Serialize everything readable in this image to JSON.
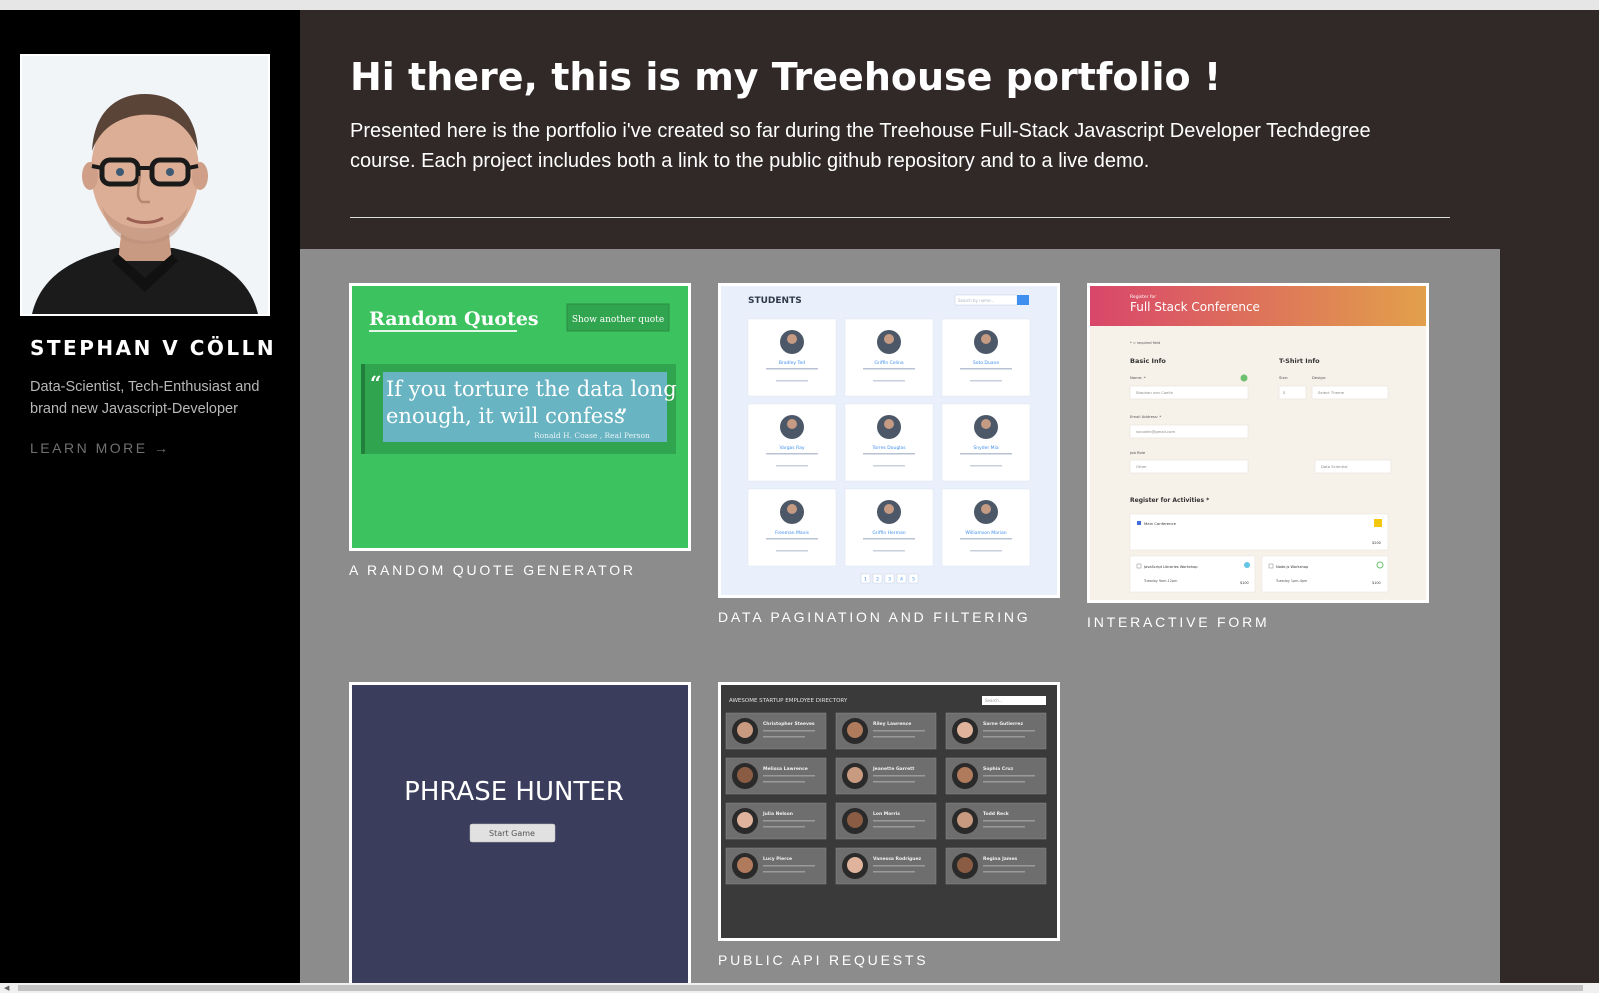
{
  "profile": {
    "name": "STEPHAN V CÖLLN",
    "tagline": "Data-Scientist, Tech-Enthusiast and brand new Javascript-Developer",
    "learn_more": "LEARN MORE →"
  },
  "header": {
    "title": "Hi there, this is my Treehouse portfolio !",
    "intro": "Presented here is the portfolio i've created so far during the Treehouse Full-Stack Javascript Developer Techdegree course. Each project includes both a link to the public github repository and to a live demo."
  },
  "projects": [
    {
      "caption": "A RANDOM QUOTE GENERATOR",
      "thumb": {
        "title": "Random Quotes",
        "button": "Show another quote",
        "quote_line1": "If you torture the data long",
        "quote_line2": "enough, it will confess",
        "quote_open": "“",
        "quote_close": "”",
        "source": "Ronald H. Coase , Real Person"
      }
    },
    {
      "caption": "DATA PAGINATION AND FILTERING",
      "thumb": {
        "header": "STUDENTS",
        "search_placeholder": "Search by name...",
        "students": [
          "Bradley Ted",
          "Griffin Celina",
          "Soto Duane",
          "Vargas Ray",
          "Torres Douglas",
          "Snyder Mia",
          "Freeman Mavis",
          "Griffin Herman",
          "Williamson Marian"
        ],
        "pages": [
          "1",
          "2",
          "3",
          "4",
          "5"
        ]
      }
    },
    {
      "caption": "INTERACTIVE FORM",
      "thumb": {
        "register_for": "Register for",
        "title": "Full Stack Conference",
        "required": "* = required field",
        "basic_info": "Basic Info",
        "tshirt_info": "T-Shirt Info",
        "name_label": "Name: *",
        "name_value": "Stephan von Coelln",
        "size_label": "Size:",
        "size_value": "S",
        "design_label": "Design:",
        "design_value": "Select Theme",
        "email_label": "Email Address: *",
        "email_value": "svcoelln@gmail.com",
        "job_label": "Job Role",
        "job_value": "Other",
        "other_job": "Data Scientist",
        "activities": "Register for Activities *",
        "main_conf": "Main Conference",
        "main_price": "$200",
        "js_workshop": "JavaScript Libraries Workshop",
        "js_time": "Tuesday 9am-12pm",
        "js_price": "$100",
        "node_workshop": "Node.js Workshop",
        "node_time": "Tuesday 1pm-4pm",
        "node_price": "$100"
      }
    },
    {
      "caption": "",
      "thumb": {
        "title": "PHRASE HUNTER",
        "button": "Start Game"
      }
    },
    {
      "caption": "PUBLIC API REQUESTS",
      "thumb": {
        "header": "AWESOME STARTUP EMPLOYEE DIRECTORY",
        "search_placeholder": "Search...",
        "employees": [
          "Christopher Steeves",
          "Riley Lawrence",
          "Sarne Gutierrez",
          "Melissa Lawrence",
          "Jeanette Garrett",
          "Sophia Cruz",
          "Julia Nelson",
          "Lon Morris",
          "Todd Reck",
          "Lucy Pierce",
          "Vanessa Rodriguez",
          "Regina James"
        ]
      }
    }
  ],
  "colors": {
    "sidebar_bg": "#000000",
    "main_bg": "#312828",
    "gallery_bg": "#8c8c8c",
    "quotes_green": "#3cc35f",
    "form_gradient_start": "#d9466a",
    "form_gradient_end": "#e2a04b",
    "phrase_bg": "#3a3e5c",
    "directory_bg": "#3a3a3a"
  }
}
